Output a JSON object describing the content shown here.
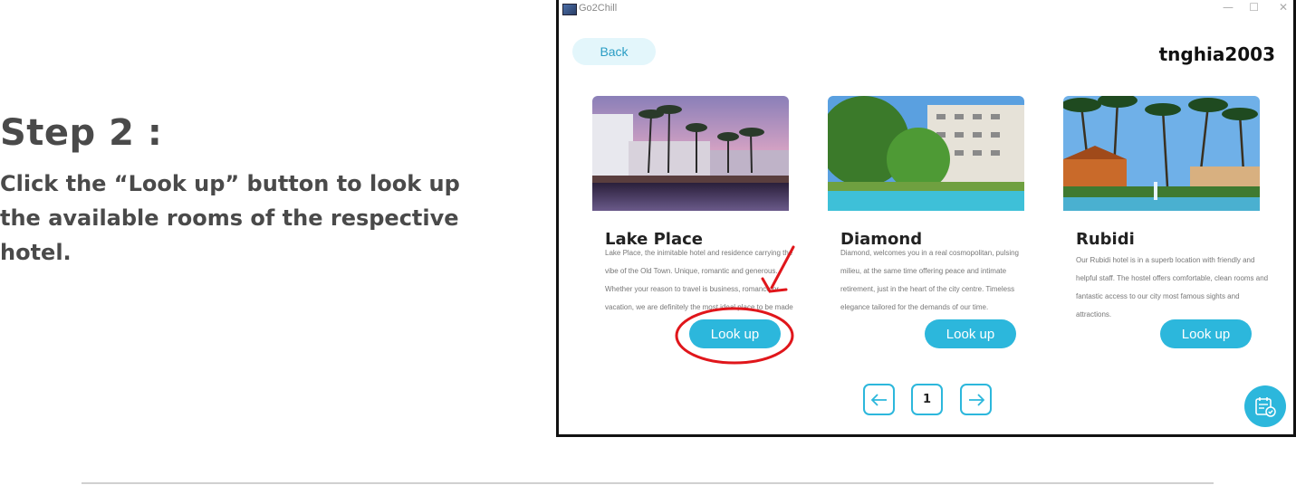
{
  "instruction": {
    "step_title": "Step 2 :",
    "step_description": "Click the “Look up” button to look up the available rooms of the respective hotel."
  },
  "window": {
    "title": "Go2Chill",
    "controls": {
      "minimize": "—",
      "maximize": "☐",
      "close": "✕"
    }
  },
  "header": {
    "back_label": "Back",
    "username": "tnghia2003"
  },
  "hotels": [
    {
      "name": "Lake Place",
      "description": "Lake Place, the inimitable hotel and residence carrying the vibe of the Old Town. Unique, romantic and generous. Whether your reason to travel is business, romance or vacation, we are definitely the most ideal place to be made",
      "button_label": "Look up",
      "image": "hotel-pool-palms-sunset"
    },
    {
      "name": "Diamond",
      "description": "Diamond, welcomes you in a real cosmopolitan, pulsing milieu, at the same time offering peace and intimate retirement, just in the heart of the city centre. Timeless elegance tailored for the demands of our time.",
      "button_label": "Look up",
      "image": "hotel-building-pool-garden"
    },
    {
      "name": "Rubidi",
      "description": "Our Rubidi hotel is in a superb location with friendly and helpful staff. The hostel offers comfortable, clean rooms and fantastic access to our city most famous sights and attractions.",
      "button_label": "Look up",
      "image": "hotel-resort-palms-fountain"
    }
  ],
  "pagination": {
    "prev_icon": "arrow-left-icon",
    "page": "1",
    "next_icon": "arrow-right-icon"
  },
  "fab_icon": "calendar-check-icon",
  "colors": {
    "accent": "#2cb7dc",
    "annotation": "#e0161b",
    "step_text": "#4a4a4a"
  }
}
